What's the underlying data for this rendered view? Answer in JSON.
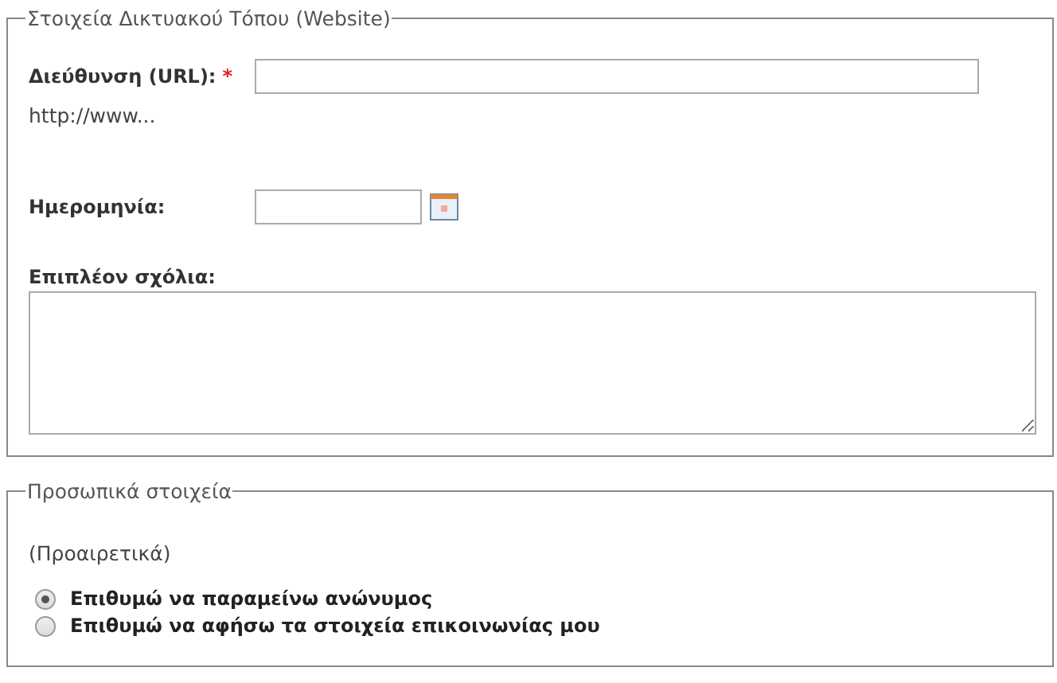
{
  "sections": [
    {
      "legend": "Στοιχεία Δικτυακού Τόπου (Website)",
      "kind": "website",
      "fields": [
        {
          "kind": "text",
          "label": "Διεύθυνση (URL):",
          "required": true,
          "hint": "http://www..."
        },
        {
          "kind": "date",
          "label": "Ημερομηνία:",
          "required": false
        },
        {
          "kind": "textarea",
          "label": "Επιπλέον σχόλια:",
          "required": false
        }
      ]
    },
    {
      "legend": "Προσωπικά στοιχεία",
      "kind": "personal",
      "note": "(Προαιρετικά)",
      "options": [
        {
          "label": "Επιθυμώ να παραμείνω ανώνυμος",
          "selected": true
        },
        {
          "label": "Επιθυμώ να αφήσω τα στοιχεία επικοινωνίας μου",
          "selected": false
        }
      ]
    }
  ],
  "required_mark": "*"
}
